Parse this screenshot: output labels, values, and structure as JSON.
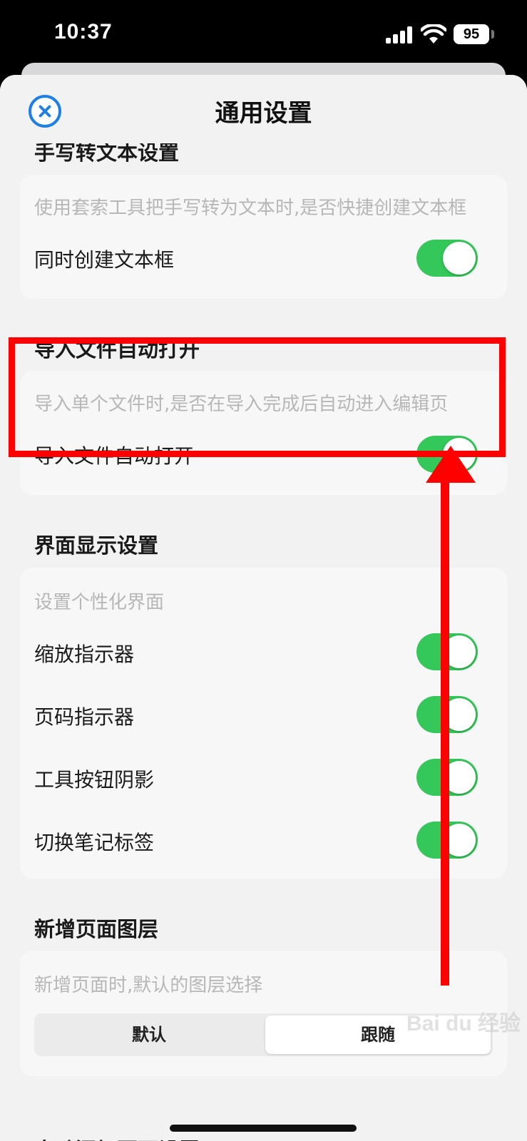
{
  "status": {
    "time": "10:37",
    "battery": "95"
  },
  "nav": {
    "title": "通用设置"
  },
  "sections": {
    "handwriting": {
      "title": "手写转文本设置",
      "desc": "使用套索工具把手写转为文本时,是否快捷创建文本框",
      "row_label": "同时创建文本框",
      "toggle_on": true
    },
    "import": {
      "title": "导入文件自动打开",
      "desc": "导入单个文件时,是否在导入完成后自动进入编辑页",
      "row_label": "导入文件自动打开",
      "toggle_on": true
    },
    "display": {
      "title": "界面显示设置",
      "desc": "设置个性化界面",
      "rows": [
        {
          "label": "缩放指示器",
          "toggle_on": true
        },
        {
          "label": "页码指示器",
          "toggle_on": true
        },
        {
          "label": "工具按钮阴影",
          "toggle_on": true
        },
        {
          "label": "切换笔记标签",
          "toggle_on": true
        }
      ]
    },
    "layer": {
      "title": "新增页面图层",
      "desc": "新增页面时,默认的图层选择",
      "options": [
        "默认",
        "跟随"
      ],
      "selected": "跟随"
    },
    "auto_add": {
      "title": "自动添加页面设置"
    }
  },
  "watermark": "Bai du 经验",
  "colors": {
    "accent": "#1f7fe5",
    "toggle_on": "#34c759",
    "annotation": "#ff0000"
  }
}
